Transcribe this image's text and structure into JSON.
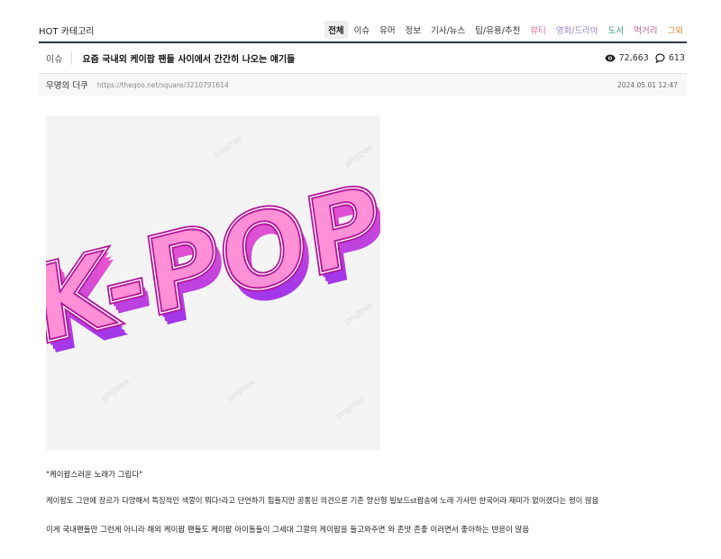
{
  "nav": {
    "brand_prefix": "HOT",
    "brand_label": "카테고리",
    "categories": [
      {
        "label": "전체",
        "color": "#222222"
      },
      {
        "label": "이슈",
        "color": "#333333"
      },
      {
        "label": "유머",
        "color": "#333333"
      },
      {
        "label": "정보",
        "color": "#333333"
      },
      {
        "label": "기사/뉴스",
        "color": "#333333"
      },
      {
        "label": "팁/유용/추천",
        "color": "#333333"
      },
      {
        "label": "뷰티",
        "color": "#e0719a"
      },
      {
        "label": "영화/드라마",
        "color": "#9b86c9"
      },
      {
        "label": "도서",
        "color": "#3aa17a"
      },
      {
        "label": "먹거리",
        "color": "#c25a8a"
      },
      {
        "label": "그외",
        "color": "#d9822b"
      }
    ]
  },
  "post": {
    "tag": "이슈",
    "title": "요즘 국내외 케이팝 팬들 사이에서 간간히 나오는 얘기들",
    "views": "72,663",
    "comments": "613",
    "author": "무명의 더쿠",
    "url": "https://theqoo.net/square/3210791614",
    "date": "2024.05.01 12:47"
  },
  "image": {
    "text": "K-POP",
    "watermark": "pngtree",
    "colors": {
      "face": "#ff8fd6",
      "outline": "#b4189a",
      "extrude_top": "#ff5ec7",
      "extrude_bottom": "#8a2cf2",
      "background": "#f4f4f4"
    }
  },
  "content": {
    "quote": "\"케이팝스러운 노래가 그립다\"",
    "paragraph1": "케이팝도 그안에 장르가 다양해서 특징적인 색깔이 뭐다!라고 단언하기 힘들지만 공통된 의견으론 기존 양산형 빌보드st팝송에 노래 가사만 한국어라 재미가 없어졌다는 평이 많음",
    "paragraph2": "이게 국내팬들만 그런게 아니라 해외 케이팝 팬들도 케이팝 아이돌들이 그세대 그깔의 케이팝을 들고와주면 와 존맛 존좋 이러면서 좋아하는 반응이 많음"
  }
}
